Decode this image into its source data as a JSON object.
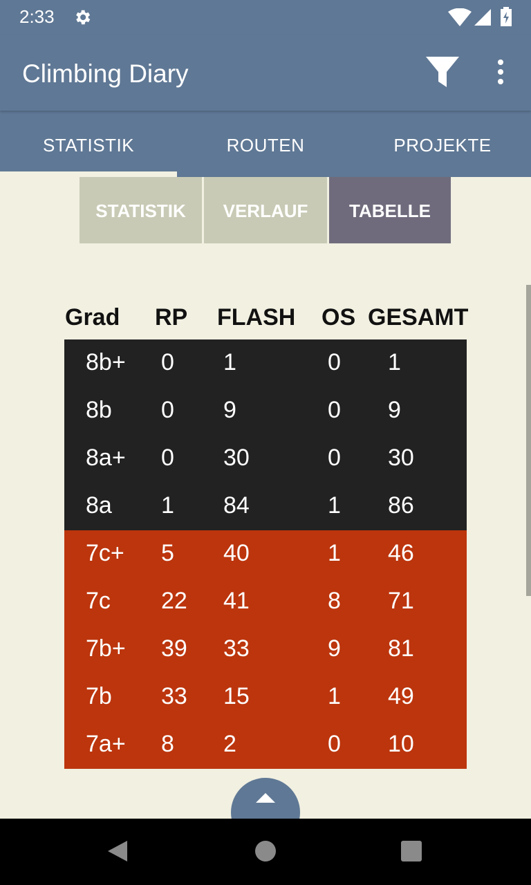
{
  "status_bar": {
    "time": "2:33",
    "icons": [
      "gear-icon",
      "wifi-icon",
      "signal-icon",
      "battery-charging-icon"
    ]
  },
  "app_bar": {
    "title": "Climbing Diary",
    "actions": [
      "filter-icon",
      "more-vert-icon"
    ]
  },
  "tabs": [
    {
      "label": "STATISTIK",
      "selected": true
    },
    {
      "label": "ROUTEN",
      "selected": false
    },
    {
      "label": "PROJEKTE",
      "selected": false
    }
  ],
  "segments": [
    {
      "label": "STATISTIK",
      "selected": false
    },
    {
      "label": "VERLAUF",
      "selected": false
    },
    {
      "label": "TABELLE",
      "selected": true
    }
  ],
  "table": {
    "headers": [
      "Grad",
      "RP",
      "FLASH",
      "OS",
      "GESAMT"
    ],
    "rows": [
      {
        "grade": "8b+",
        "rp": "0",
        "flash": "1",
        "os": "0",
        "total": "1",
        "group": "dark"
      },
      {
        "grade": "8b",
        "rp": "0",
        "flash": "9",
        "os": "0",
        "total": "9",
        "group": "dark"
      },
      {
        "grade": "8a+",
        "rp": "0",
        "flash": "30",
        "os": "0",
        "total": "30",
        "group": "dark"
      },
      {
        "grade": "8a",
        "rp": "1",
        "flash": "84",
        "os": "1",
        "total": "86",
        "group": "dark"
      },
      {
        "grade": "7c+",
        "rp": "5",
        "flash": "40",
        "os": "1",
        "total": "46",
        "group": "red"
      },
      {
        "grade": "7c",
        "rp": "22",
        "flash": "41",
        "os": "8",
        "total": "71",
        "group": "red"
      },
      {
        "grade": "7b+",
        "rp": "39",
        "flash": "33",
        "os": "9",
        "total": "81",
        "group": "red"
      },
      {
        "grade": "7b",
        "rp": "33",
        "flash": "15",
        "os": "1",
        "total": "49",
        "group": "red"
      },
      {
        "grade": "7a+",
        "rp": "8",
        "flash": "2",
        "os": "0",
        "total": "10",
        "group": "red"
      }
    ]
  },
  "fab": {
    "icon": "chevron-up-icon"
  },
  "nav_bar": {
    "icons": [
      "back-icon",
      "home-icon",
      "recents-icon"
    ]
  },
  "colors": {
    "primary": "#5f7895",
    "background": "#f1f0e1",
    "segment_inactive": "#c9cab5",
    "segment_active": "#706b7c",
    "row_dark": "#222222",
    "row_red": "#bc350d"
  }
}
